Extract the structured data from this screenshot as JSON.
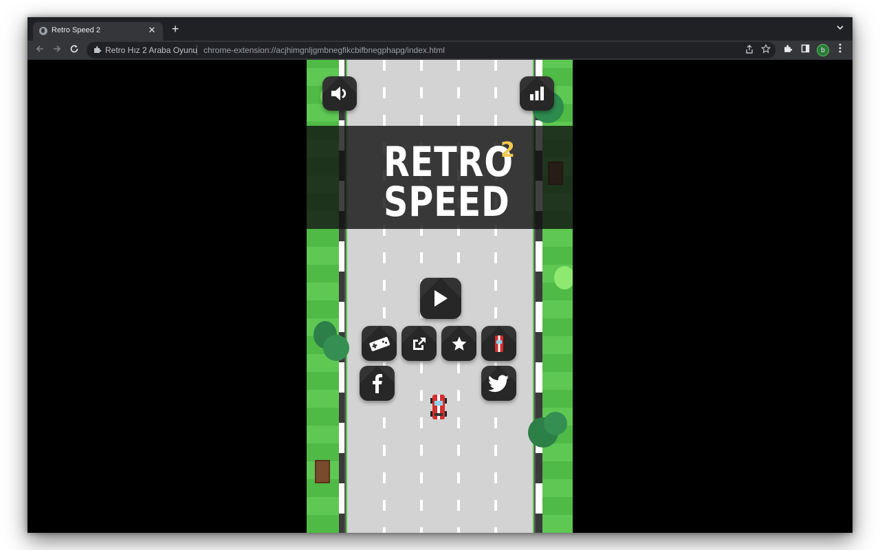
{
  "browser": {
    "tab_title": "Retro Speed 2",
    "tab_close": "✕",
    "new_tab": "+",
    "site_name": "Retro Hız 2 Araba Oyunu",
    "url": "chrome-extension://acjhimgnljgmbnegfikcbifbnegphapg/index.html",
    "profile_initial": "b"
  },
  "game": {
    "logo_line1": "RETRO",
    "logo_line2": "SPEED",
    "logo_sup": "2",
    "colors": {
      "grass": "#56c24a",
      "road": "#d3d3d3",
      "button": "#333333",
      "logo_accent": "#f2c94c",
      "car": "#d32f2f"
    },
    "buttons": [
      {
        "name": "sound-button",
        "icon": "speaker-icon"
      },
      {
        "name": "leaderboard-button",
        "icon": "bar-chart-icon"
      },
      {
        "name": "play-button",
        "icon": "play-icon"
      },
      {
        "name": "controls-button",
        "icon": "gamepad-icon"
      },
      {
        "name": "share-button",
        "icon": "external-link-icon"
      },
      {
        "name": "rate-button",
        "icon": "star-icon"
      },
      {
        "name": "car-select-button",
        "icon": "car-icon"
      },
      {
        "name": "facebook-button",
        "icon": "facebook-icon"
      },
      {
        "name": "twitter-button",
        "icon": "twitter-icon"
      }
    ]
  }
}
